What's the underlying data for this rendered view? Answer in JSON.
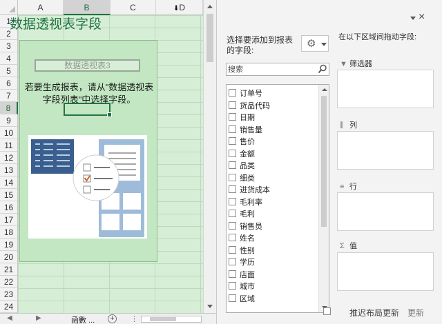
{
  "sheet": {
    "columns": [
      "A",
      "B",
      "C",
      "D"
    ],
    "selected_column": "B",
    "rows": [
      "1",
      "2",
      "3",
      "4",
      "5",
      "6",
      "7",
      "8",
      "9",
      "10",
      "11",
      "12",
      "13",
      "14",
      "15",
      "16",
      "17",
      "18",
      "19",
      "20",
      "21",
      "22",
      "23",
      "24"
    ],
    "selected_row": "8",
    "pivot_table_name": "数据透视表3",
    "pivot_hint": "若要生成报表，请从\"数据透视表字段列表\"中选择字段。",
    "tab_label": "函數 ...",
    "add_sheet_symbol": "+",
    "more_symbol": "⋮",
    "nav_prev": "◀",
    "nav_next": "▶"
  },
  "pane": {
    "title": "数据透视表字段",
    "close_symbol": "×",
    "choose_label": "选择要添加到报表的字段:",
    "search_placeholder": "搜索",
    "fields": [
      "订单号",
      "货品代码",
      "日期",
      "销售量",
      "售价",
      "金额",
      "品类",
      "细类",
      "进货成本",
      "毛利率",
      "毛利",
      "销售员",
      "姓名",
      "性别",
      "学历",
      "店面",
      "城市",
      "区域"
    ],
    "drag_label": "在以下区域间拖动字段:",
    "areas": [
      {
        "icon": "▼",
        "label": "筛选器"
      },
      {
        "icon": "⫼",
        "label": "列"
      },
      {
        "icon": "≡",
        "label": "行"
      },
      {
        "icon": "Σ",
        "label": "值"
      }
    ],
    "defer_label": "推迟布局更新",
    "update_label": "更新"
  },
  "colors": {
    "accent": "#217346",
    "selection_fill": "#d5eed5",
    "pivot_fill": "#c2e7c2"
  }
}
